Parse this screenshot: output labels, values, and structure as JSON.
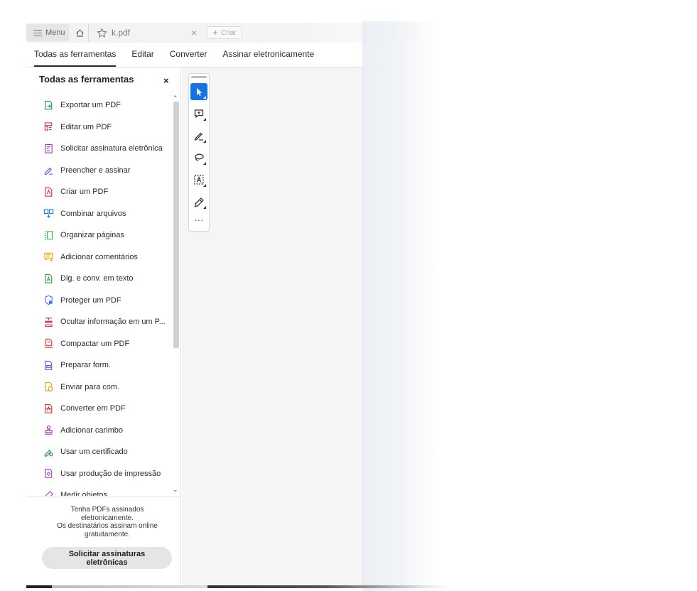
{
  "tabbar": {
    "menu_label": "Menu",
    "file_name": "k.pdf",
    "new_label": "Criar"
  },
  "menubar": {
    "items": [
      "Todas as ferramentas",
      "Editar",
      "Converter",
      "Assinar eletronicamente"
    ],
    "active_index": 0
  },
  "panel": {
    "title": "Todas as ferramentas",
    "close_glyph": "×",
    "tools": [
      {
        "label": "Exportar um PDF",
        "icon": "export-pdf-icon",
        "color": "#1a8a7a"
      },
      {
        "label": "Editar um PDF",
        "icon": "edit-pdf-icon",
        "color": "#d6336c"
      },
      {
        "label": "Solicitar assinatura eletrônica",
        "icon": "request-signature-icon",
        "color": "#9c36b5"
      },
      {
        "label": "Preencher e assinar",
        "icon": "fill-sign-icon",
        "color": "#7048e8"
      },
      {
        "label": "Criar um PDF",
        "icon": "create-pdf-icon",
        "color": "#e03131"
      },
      {
        "label": "Combinar arquivos",
        "icon": "combine-files-icon",
        "color": "#1c7ed6"
      },
      {
        "label": "Organizar páginas",
        "icon": "organize-pages-icon",
        "color": "#37b24d"
      },
      {
        "label": "Adicionar comentários",
        "icon": "add-comment-icon",
        "color": "#f59f00"
      },
      {
        "label": "Dig. e conv. em texto",
        "icon": "scan-ocr-icon",
        "color": "#2f9e44"
      },
      {
        "label": "Proteger um PDF",
        "icon": "protect-pdf-icon",
        "color": "#4c6ef5"
      },
      {
        "label": "Ocultar informação em um P...",
        "icon": "redact-icon",
        "color": "#d6336c"
      },
      {
        "label": "Compactar um PDF",
        "icon": "compress-pdf-icon",
        "color": "#e03131"
      },
      {
        "label": "Preparar form.",
        "icon": "prepare-form-icon",
        "color": "#7048e8"
      },
      {
        "label": "Enviar para com.",
        "icon": "send-comment-icon",
        "color": "#f59f00"
      },
      {
        "label": "Converter em PDF",
        "icon": "convert-pdf-icon",
        "color": "#e03131"
      },
      {
        "label": "Adicionar carimbo",
        "icon": "stamp-icon",
        "color": "#9c36b5"
      },
      {
        "label": "Usar um certificado",
        "icon": "certificate-icon",
        "color": "#1a8a7a"
      },
      {
        "label": "Usar produção de impressão",
        "icon": "print-production-icon",
        "color": "#ae3ec9"
      },
      {
        "label": "Medir objetos",
        "icon": "measure-icon",
        "color": "#ae3ec9"
      }
    ],
    "promo_text": "Tenha PDFs assinados eletronicamente. Os destinatários assinam online gratuitamente.",
    "promo_line1": "Tenha PDFs assinados",
    "promo_line2": "eletronicamente.",
    "promo_line3": "Os destinatários assinam online",
    "promo_line4": "gratuitamente.",
    "promo_button_line1": "Solicitar assinaturas",
    "promo_button_line2": "eletrônicas"
  },
  "vertical_toolbar": {
    "tools": [
      "select-cursor-icon",
      "comment-icon",
      "draw-pen-icon",
      "lasso-icon",
      "text-select-icon",
      "sign-pen-icon"
    ],
    "more_glyph": "···",
    "accent": "#1473e6"
  }
}
